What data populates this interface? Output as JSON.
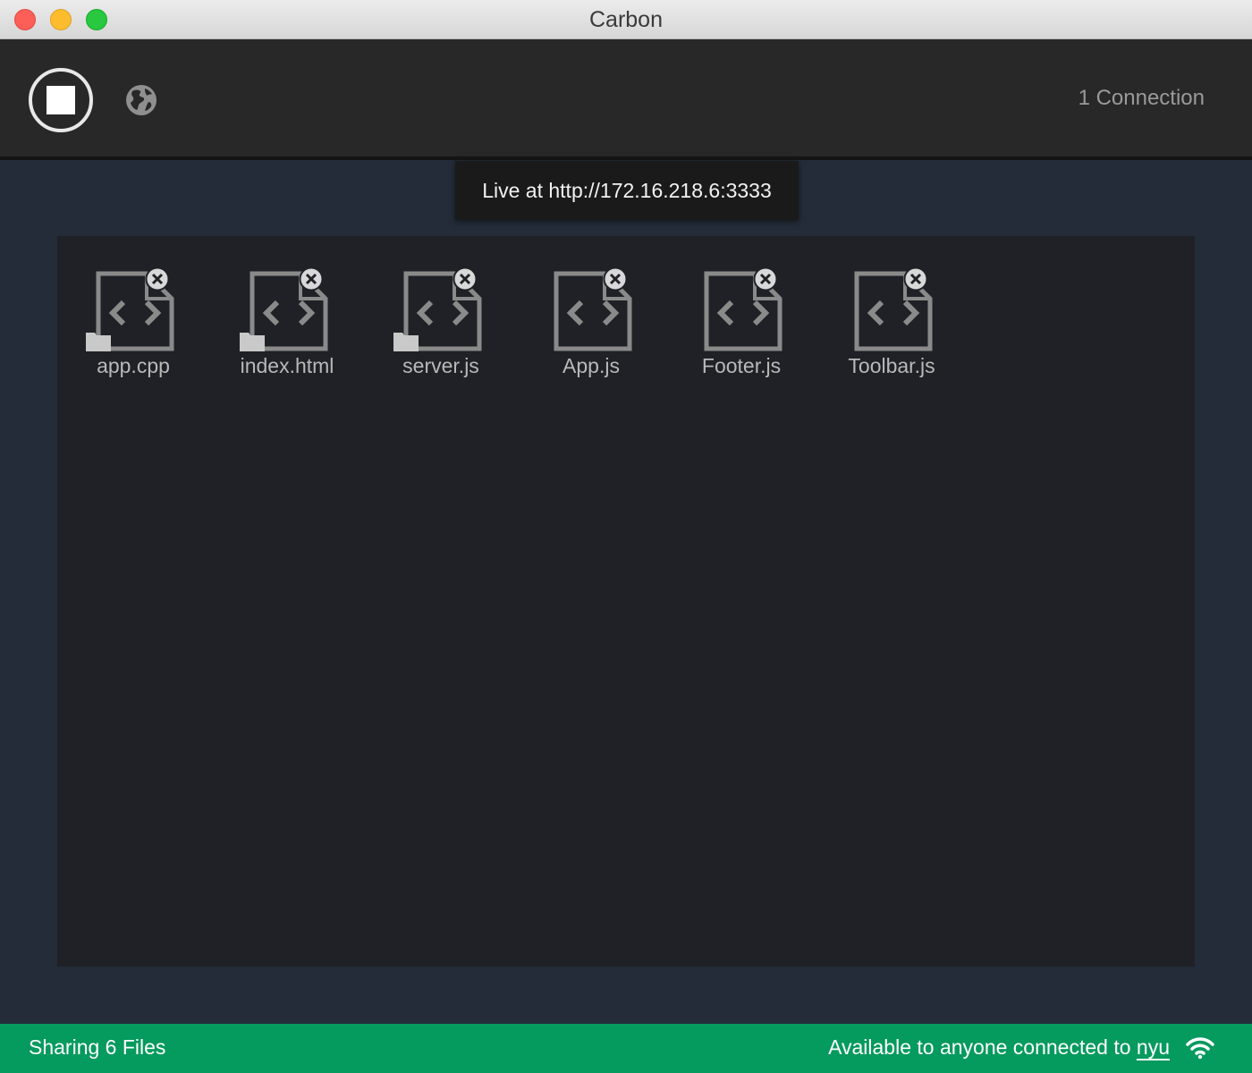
{
  "window": {
    "title": "Carbon"
  },
  "toolbar": {
    "stop_icon": "stop-icon",
    "globe_icon": "globe-icon",
    "connections": "1 Connection"
  },
  "tooltip": {
    "text": "Live at http://172.16.218.6:3333"
  },
  "files": [
    {
      "name": "app.cpp",
      "has_folder": true
    },
    {
      "name": "index.html",
      "has_folder": true
    },
    {
      "name": "server.js",
      "has_folder": true
    },
    {
      "name": "App.js",
      "has_folder": false
    },
    {
      "name": "Footer.js",
      "has_folder": false
    },
    {
      "name": "Toolbar.js",
      "has_folder": false
    }
  ],
  "statusbar": {
    "sharing": "Sharing 6 Files",
    "available_prefix": "Available to anyone connected to ",
    "network": "nyu",
    "wifi_icon": "wifi-icon"
  },
  "colors": {
    "status_green": "#059a5e",
    "background": "#232c38",
    "dropzone": "#1f2126",
    "toolbar": "#282828"
  }
}
